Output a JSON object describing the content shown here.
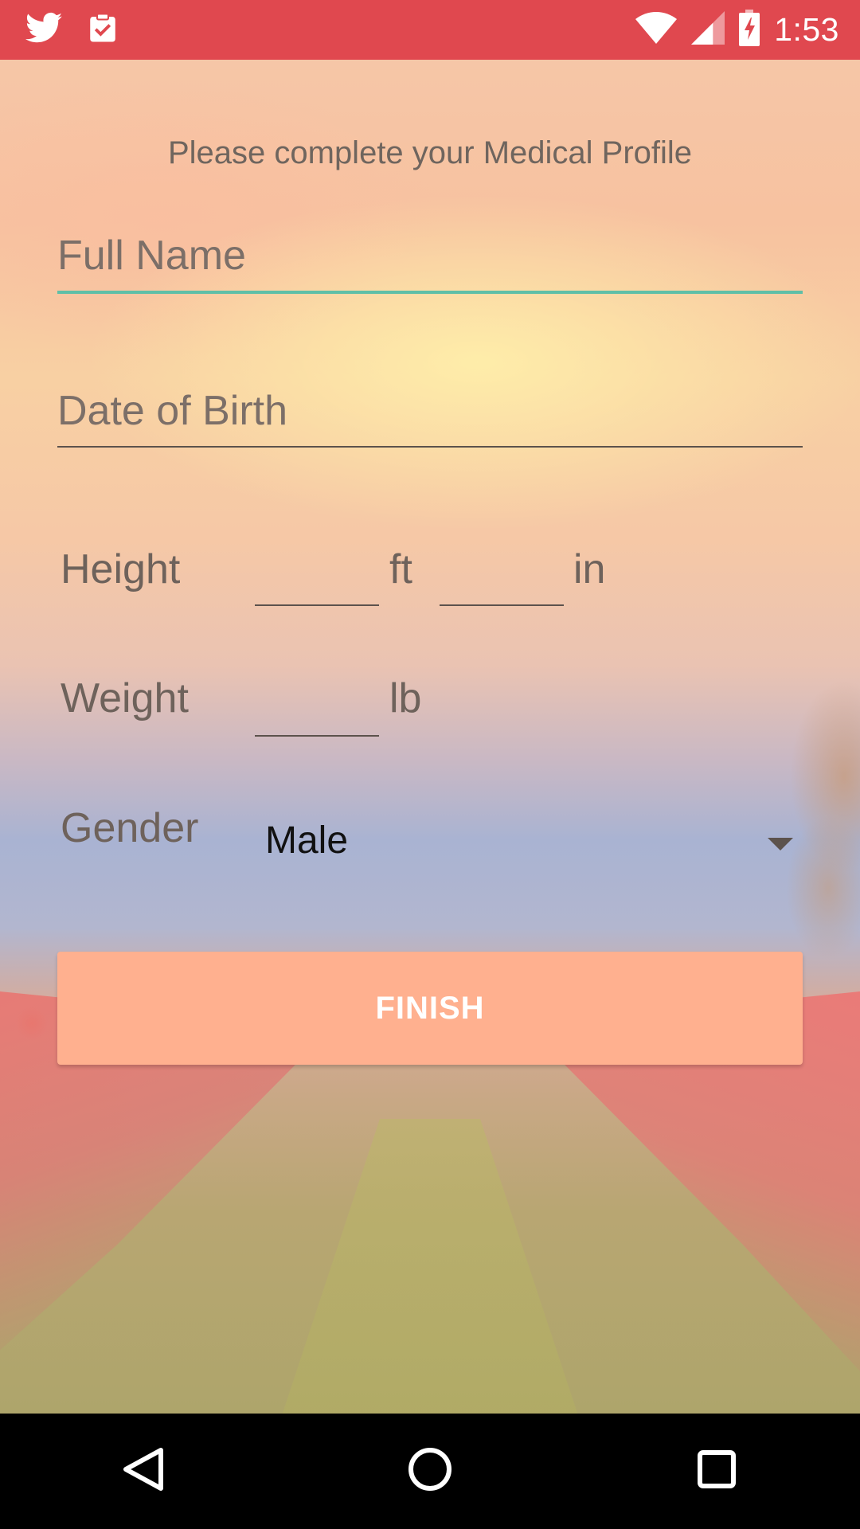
{
  "status_bar": {
    "time": "1:53",
    "left_icons": [
      "twitter-icon",
      "clipboard-check-icon"
    ],
    "right_icons": [
      "wifi-icon",
      "cell-signal-icon",
      "battery-charging-icon"
    ]
  },
  "form": {
    "title": "Please complete your Medical Profile",
    "full_name": {
      "placeholder": "Full Name",
      "value": ""
    },
    "date_of_birth": {
      "placeholder": "Date of Birth",
      "value": ""
    },
    "height": {
      "label": "Height",
      "feet": "",
      "feet_unit": "ft",
      "inches": "",
      "inches_unit": "in"
    },
    "weight": {
      "label": "Weight",
      "value": "",
      "unit": "lb"
    },
    "gender": {
      "label": "Gender",
      "selected": "Male"
    },
    "finish_label": "FINISH"
  },
  "nav_bar": {
    "icons": [
      "back-icon",
      "home-icon",
      "recents-icon"
    ]
  },
  "colors": {
    "status_bar": "#e0484f",
    "focus_accent": "#60bfa7",
    "finish_button": "#ffb08f"
  }
}
